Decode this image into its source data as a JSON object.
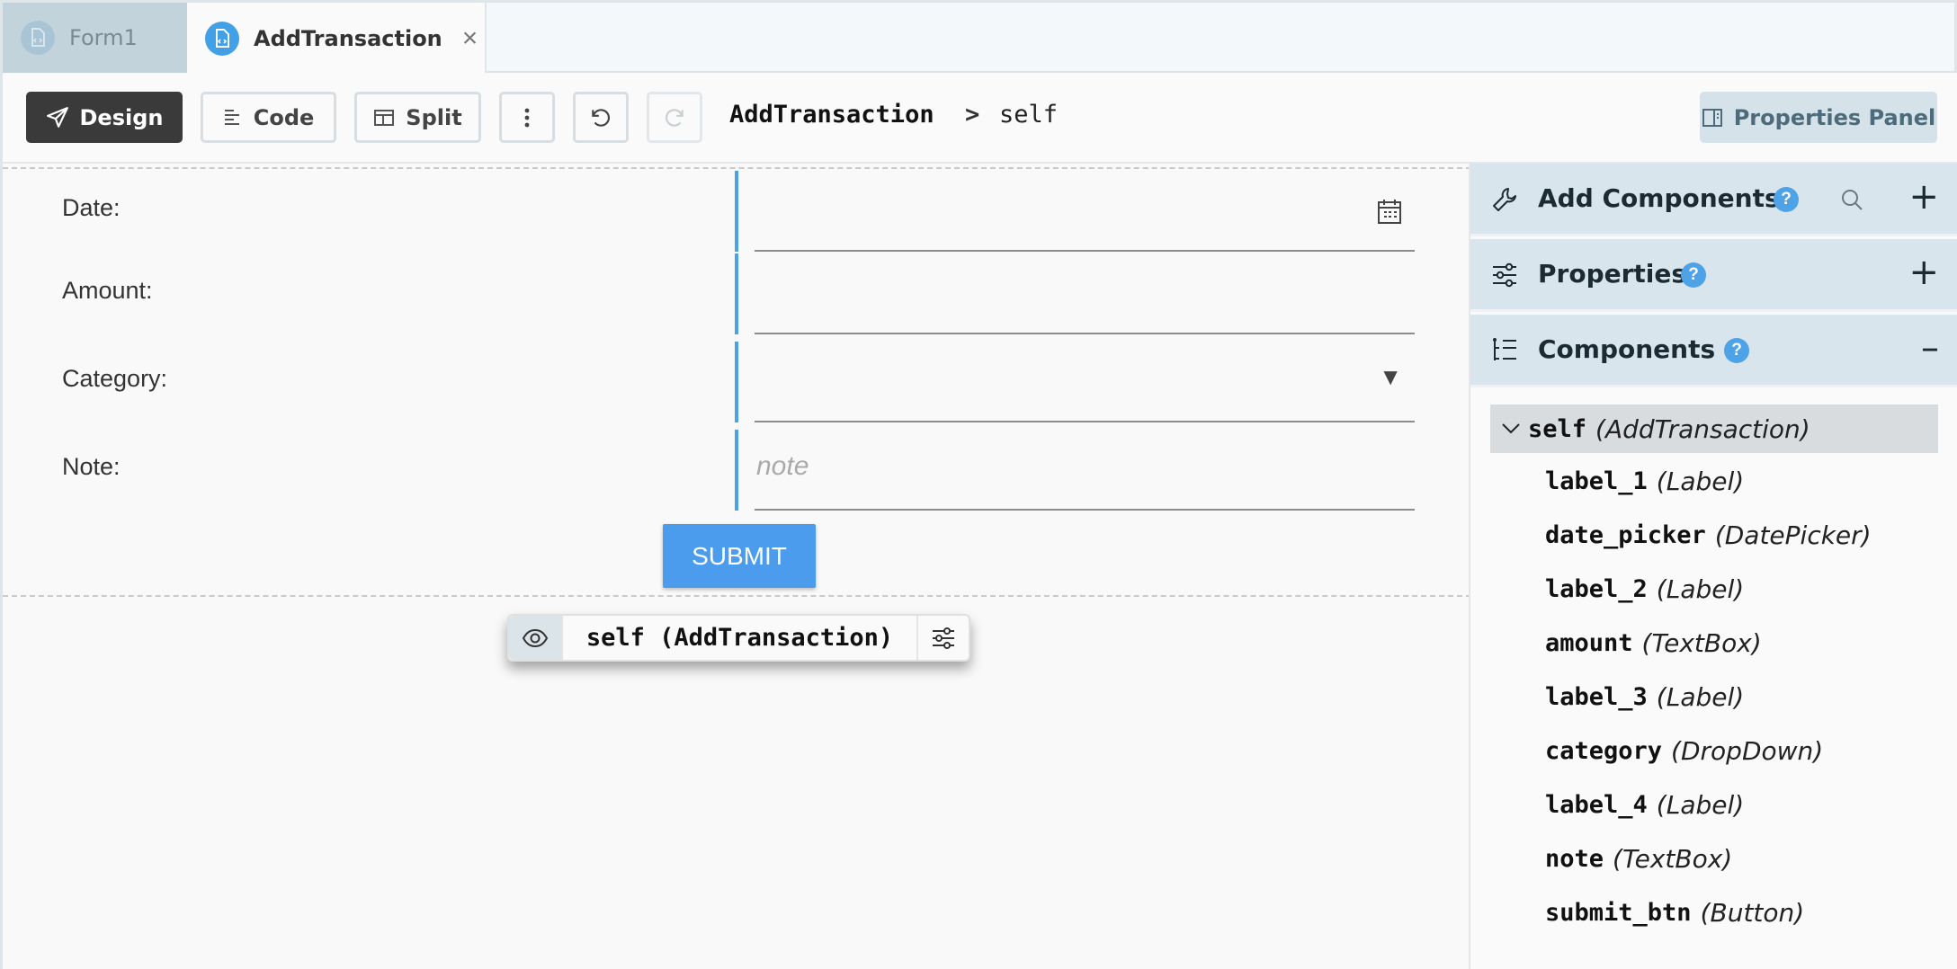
{
  "tabs": [
    {
      "label": "Form1",
      "active": false
    },
    {
      "label": "AddTransaction",
      "active": true
    }
  ],
  "toolbar": {
    "design_label": "Design",
    "code_label": "Code",
    "split_label": "Split",
    "breadcrumb_form": "AddTransaction",
    "breadcrumb_sep": ">",
    "breadcrumb_self": "self",
    "properties_panel_label": "Properties Panel"
  },
  "form": {
    "date_label": "Date:",
    "amount_label": "Amount:",
    "category_label": "Category:",
    "note_label": "Note:",
    "note_placeholder": "note",
    "submit_label": "SUBMIT",
    "selection_label": "self (AddTransaction)"
  },
  "panel": {
    "add_components_title": "Add Components",
    "properties_title": "Properties",
    "components_title": "Components",
    "help_glyph": "?",
    "plus_glyph": "+",
    "minus_glyph": "–",
    "tree_root": {
      "name": "self",
      "type": "(AddTransaction)"
    },
    "tree_items": [
      {
        "name": "label_1",
        "type": "(Label)"
      },
      {
        "name": "date_picker",
        "type": "(DatePicker)"
      },
      {
        "name": "label_2",
        "type": "(Label)"
      },
      {
        "name": "amount",
        "type": "(TextBox)"
      },
      {
        "name": "label_3",
        "type": "(Label)"
      },
      {
        "name": "category",
        "type": "(DropDown)"
      },
      {
        "name": "label_4",
        "type": "(Label)"
      },
      {
        "name": "note",
        "type": "(TextBox)"
      },
      {
        "name": "submit_btn",
        "type": "(Button)"
      }
    ]
  },
  "colors": {
    "accent_blue": "#4b9cec",
    "design_button_bg": "#3a3a3a",
    "panel_header_bg": "#d8e5ec",
    "field_left_border": "#4aa3e3"
  }
}
